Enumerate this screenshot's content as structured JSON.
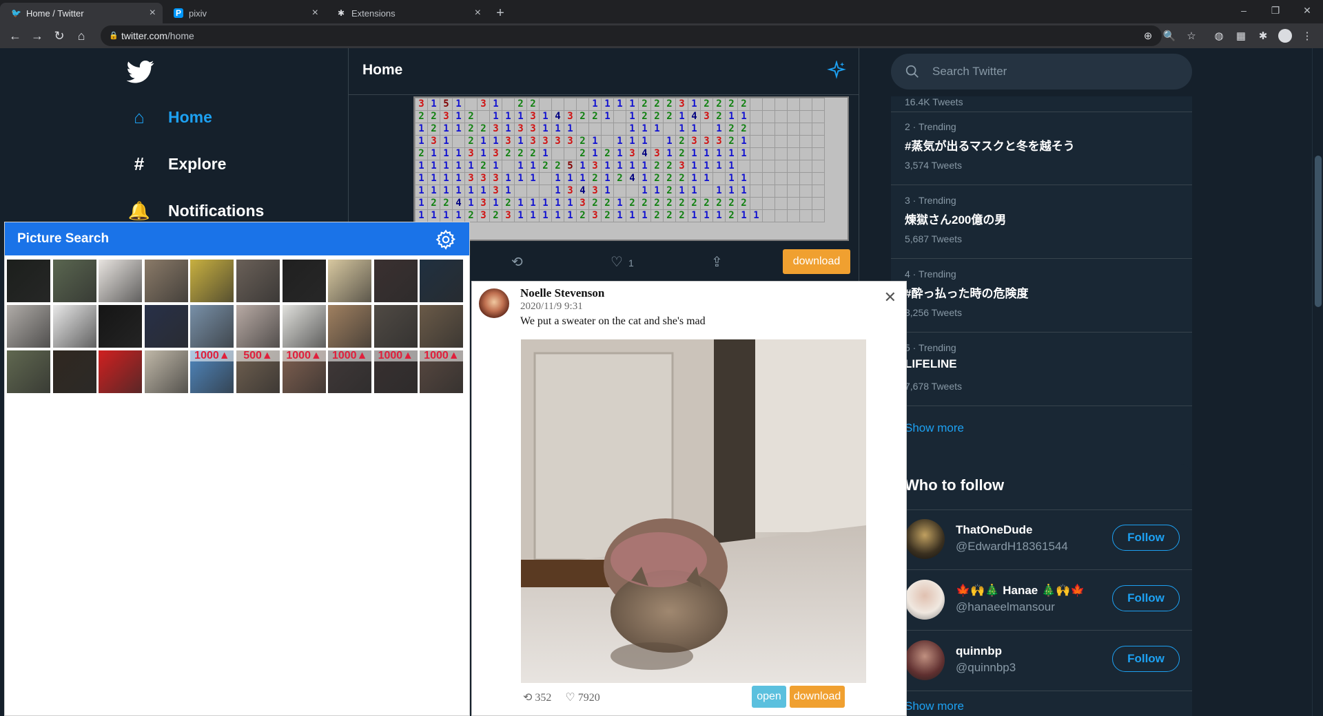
{
  "browser": {
    "tabs": [
      {
        "title": "Home / Twitter",
        "icon": "twitter-icon"
      },
      {
        "title": "pixiv",
        "icon": "pixiv-icon"
      },
      {
        "title": "Extensions",
        "icon": "puzzle-icon"
      }
    ],
    "url_host": "twitter.com",
    "url_path": "/home"
  },
  "twitter": {
    "nav": [
      {
        "label": "Home",
        "icon": "home-icon"
      },
      {
        "label": "Explore",
        "icon": "hashtag-icon"
      },
      {
        "label": "Notifications",
        "icon": "bell-icon"
      }
    ],
    "center_title": "Home",
    "tweet_actions": {
      "likes": "1",
      "download_label": "download"
    },
    "search_placeholder": "Search Twitter",
    "trends_top_count": "16.4K Tweets",
    "trends": [
      {
        "meta": "2 · Trending",
        "name": "#蒸気が出るマスクと冬を越そう",
        "count": "3,574 Tweets"
      },
      {
        "meta": "3 · Trending",
        "name": "煉獄さん200億の男",
        "count": "5,687 Tweets"
      },
      {
        "meta": "4 · Trending",
        "name": "#酔っ払った時の危険度",
        "count": "3,256 Tweets"
      },
      {
        "meta": "5 · Trending",
        "name": "LIFELINE",
        "count": "7,678 Tweets"
      }
    ],
    "show_more": "Show more",
    "who_to_follow": {
      "title": "Who to follow",
      "accounts": [
        {
          "name": "ThatOneDude",
          "handle": "@EdwardH18361544",
          "button": "Follow"
        },
        {
          "name": "🍁🙌🎄 Hanae 🎄🙌🍁",
          "handle": "@hanaeelmansour",
          "button": "Follow"
        },
        {
          "name": "quinnbp",
          "handle": "@quinnbp3",
          "button": "Follow"
        }
      ],
      "show_more": "Show more"
    }
  },
  "picture_search": {
    "title": "Picture Search",
    "thumbnails": [
      {
        "badge": ""
      },
      {
        "badge": ""
      },
      {
        "badge": ""
      },
      {
        "badge": ""
      },
      {
        "badge": ""
      },
      {
        "badge": ""
      },
      {
        "badge": ""
      },
      {
        "badge": ""
      },
      {
        "badge": ""
      },
      {
        "badge": ""
      },
      {
        "badge": ""
      },
      {
        "badge": ""
      },
      {
        "badge": ""
      },
      {
        "badge": ""
      },
      {
        "badge": ""
      },
      {
        "badge": ""
      },
      {
        "badge": ""
      },
      {
        "badge": ""
      },
      {
        "badge": ""
      },
      {
        "badge": ""
      },
      {
        "badge": ""
      },
      {
        "badge": ""
      },
      {
        "badge": ""
      },
      {
        "badge": ""
      },
      {
        "badge": "1000▲"
      },
      {
        "badge": "500▲"
      },
      {
        "badge": "1000▲"
      },
      {
        "badge": "1000▲"
      },
      {
        "badge": "1000▲"
      },
      {
        "badge": "1000▲"
      }
    ],
    "thumbnail_colors": [
      "#1c1f1c",
      "#5a6650",
      "#e8e4e0",
      "#8a7a68",
      "#c8b040",
      "#6a6058",
      "#202020",
      "#d8c8a0",
      "#3a3030",
      "#203040",
      "#b0aca8",
      "#e8e8e8",
      "#151515",
      "#283048",
      "#7890a8",
      "#b8aaa4",
      "#e0e0dc",
      "#a08060",
      "#504a44",
      "#6a5a48",
      "#606850",
      "#302820",
      "#d02020",
      "#c0b8a8",
      "#5088c0",
      "#706050",
      "#806050",
      "#403838",
      "#383030",
      "#584840"
    ]
  },
  "tweet_detail": {
    "author": "Noelle Stevenson",
    "date": "2020/11/9 9:31",
    "text": "We put a sweater on the cat and she's mad",
    "retweets": "352",
    "likes": "7920",
    "open_label": "open",
    "download_label": "download"
  },
  "minesweeper_rows": [
    "3151 31 22    1111222312222",
    "22312 1113143221 1222143211",
    "1211223133111    111 11 122",
    "131 21131333321 111 1233321",
    "21113132221  21213431211111",
    "1111121 112251311112231111",
    "1111333111 1112124122211 11",
    "11111131   13431  11211 111",
    "122413121111132212222222222",
    "1111232311111232111222111211"
  ],
  "colors": {
    "twitter_blue": "#1da1f2",
    "background": "#15202b",
    "panel": "#192734",
    "download_orange": "#f0a030",
    "open_cyan": "#5bc0de",
    "ps_header": "#1a73e8"
  }
}
